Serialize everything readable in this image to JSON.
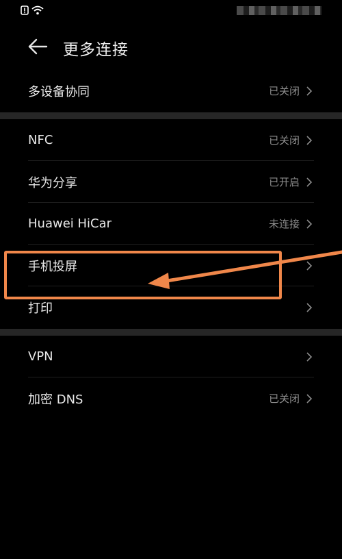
{
  "page": {
    "title": "更多连接"
  },
  "status_bar": {
    "icons": [
      "alert-icon",
      "wifi-icon"
    ]
  },
  "groups": [
    {
      "items": [
        {
          "label": "多设备协同",
          "value": "已关闭"
        }
      ]
    },
    {
      "items": [
        {
          "label": "NFC",
          "value": "已关闭"
        },
        {
          "label": "华为分享",
          "value": "已开启"
        },
        {
          "label": "Huawei HiCar",
          "value": "未连接"
        },
        {
          "label": "手机投屏",
          "value": ""
        },
        {
          "label": "打印",
          "value": ""
        }
      ]
    },
    {
      "items": [
        {
          "label": "VPN",
          "value": ""
        },
        {
          "label": "加密 DNS",
          "value": "已关闭"
        }
      ]
    }
  ],
  "annotation": {
    "highlighted_item": "手机投屏",
    "color": "#f0874a"
  },
  "colors": {
    "background": "#000000",
    "section_separator": "#262626",
    "label": "#e8e8e8",
    "value": "#8e8e8e"
  }
}
